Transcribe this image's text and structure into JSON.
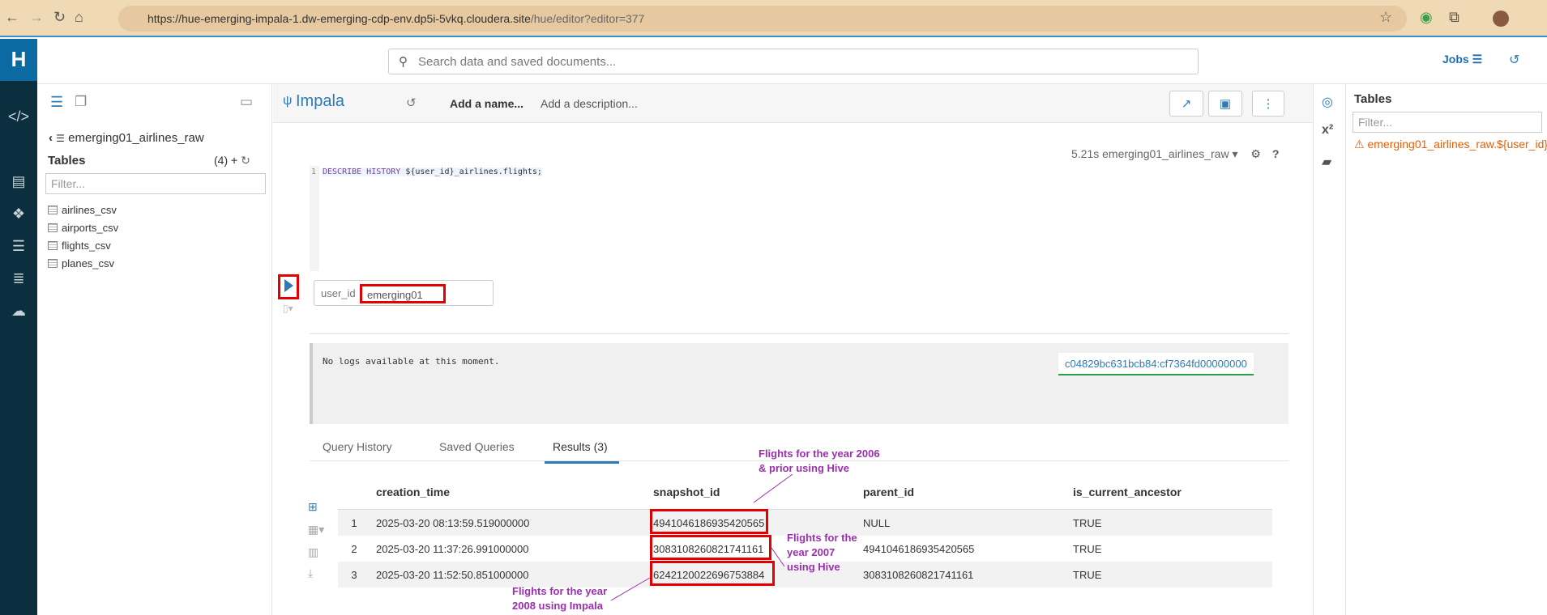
{
  "browser": {
    "url_host": "https://hue-emerging-impala-1.dw-emerging-cdp-env.dp5i-5vkq.cloudera.site",
    "url_path": "/hue/editor?editor=377"
  },
  "topbar": {
    "search_placeholder": "Search data and saved documents...",
    "jobs_label": "Jobs"
  },
  "sidebar": {
    "database": "emerging01_airlines_raw",
    "tables_heading": "Tables",
    "tables_count": "(4)",
    "filter_placeholder": "Filter...",
    "tables": [
      "airlines_csv",
      "airports_csv",
      "flights_csv",
      "planes_csv"
    ]
  },
  "editor": {
    "engine": "Impala",
    "name_placeholder": "Add a name...",
    "description_placeholder": "Add a description...",
    "query_info": "5.21s emerging01_airlines_raw",
    "line_number": "1",
    "code_keyword": "DESCRIBE HISTORY",
    "code_rest": " ${user_id}_airlines.flights;",
    "variable_label": "user_id",
    "variable_value": "emerging01"
  },
  "logs": {
    "text": "No logs available at this moment.",
    "query_id": "c04829bc631bcb84:cf7364fd00000000"
  },
  "tabs": [
    "Query History",
    "Saved Queries",
    "Results (3)"
  ],
  "results": {
    "columns": [
      "creation_time",
      "snapshot_id",
      "parent_id",
      "is_current_ancestor"
    ],
    "rows": [
      [
        "1",
        "2025-03-20 08:13:59.519000000",
        "4941046186935420565",
        "NULL",
        "TRUE"
      ],
      [
        "2",
        "2025-03-20 11:37:26.991000000",
        "3083108260821741161",
        "4941046186935420565",
        "TRUE"
      ],
      [
        "3",
        "2025-03-20 11:52:50.851000000",
        "6242120022696753884",
        "3083108260821741161",
        "TRUE"
      ]
    ]
  },
  "annotations": {
    "note1_line1": "Flights for the year 2006",
    "note1_line2": "& prior using Hive",
    "note2_line1": "Flights for the",
    "note2_line2": "year 2007",
    "note2_line3": "using Hive",
    "note3_line1": "Flights for the year",
    "note3_line2": "2008 using Impala"
  },
  "assist": {
    "heading": "Tables",
    "filter_placeholder": "Filter...",
    "warning": "emerging01_airlines_raw.${user_id}"
  },
  "colors": {
    "accent": "#2c7bb5",
    "highlight": "#e30000",
    "annotation": "#9b2fae",
    "rail": "#0b2f3f"
  },
  "icons": [
    "back-icon",
    "forward-icon",
    "reload-icon",
    "home-icon",
    "star-icon",
    "extensions-icon",
    "profile-icon",
    "search-icon",
    "jobs-icon",
    "history-icon",
    "database-icon",
    "play-icon",
    "settings-icon",
    "help-icon",
    "warning-icon",
    "compass-icon",
    "function-icon",
    "book-icon"
  ]
}
